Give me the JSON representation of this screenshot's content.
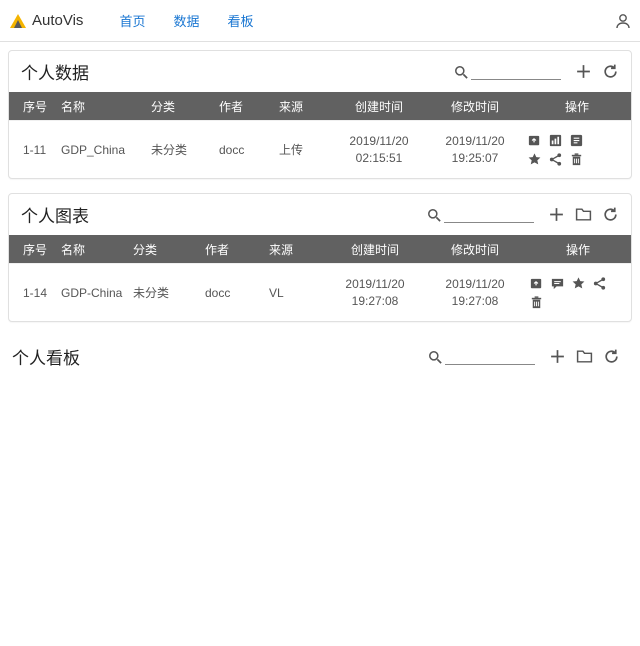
{
  "app": {
    "name": "AutoVis"
  },
  "nav": {
    "home": "首页",
    "data": "数据",
    "dashboard": "看板"
  },
  "sections": {
    "personal_data": {
      "title": "个人数据",
      "columns": {
        "seq": "序号",
        "name": "名称",
        "category": "分类",
        "author": "作者",
        "source": "来源",
        "created": "创建时间",
        "modified": "修改时间",
        "actions": "操作"
      },
      "rows": [
        {
          "seq": "1-11",
          "name": "GDP_China",
          "category": "未分类",
          "author": "docc",
          "source": "上传",
          "created_date": "2019/11/20",
          "created_time": "02:15:51",
          "modified_date": "2019/11/20",
          "modified_time": "19:25:07"
        }
      ]
    },
    "personal_charts": {
      "title": "个人图表",
      "columns": {
        "seq": "序号",
        "name": "名称",
        "category": "分类",
        "author": "作者",
        "source": "来源",
        "created": "创建时间",
        "modified": "修改时间",
        "actions": "操作"
      },
      "rows": [
        {
          "seq": "1-14",
          "name": "GDP-China",
          "category": "未分类",
          "author": "docc",
          "source": "VL",
          "created_date": "2019/11/20",
          "created_time": "19:27:08",
          "modified_date": "2019/11/20",
          "modified_time": "19:27:08"
        }
      ]
    },
    "personal_dashboards": {
      "title": "个人看板"
    }
  }
}
